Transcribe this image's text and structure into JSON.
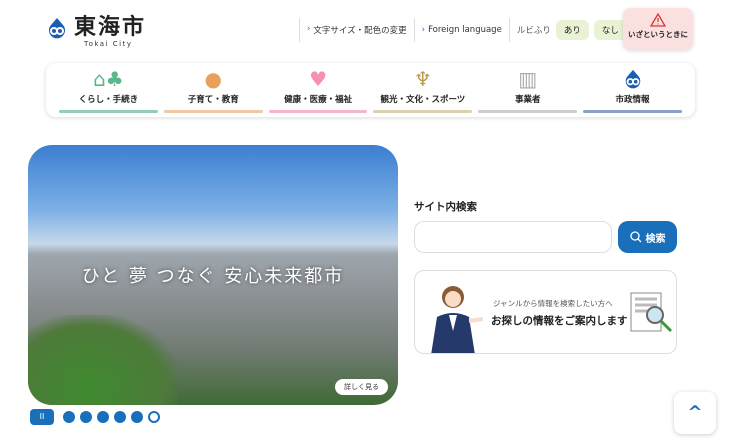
{
  "header": {
    "logo_text": "東海市",
    "logo_sub": "Tokai City",
    "text_size": "文字サイズ・配色の変更",
    "foreign": "Foreign language",
    "ruby_label": "ルビふり",
    "ruby_on": "あり",
    "ruby_off": "なし",
    "emergency": "いざというときに"
  },
  "nav": [
    {
      "label": "くらし・手続き",
      "color": "#8fcfb5"
    },
    {
      "label": "子育て・教育",
      "color": "#efc9a4"
    },
    {
      "label": "健康・医療・福祉",
      "color": "#f6b5cb"
    },
    {
      "label": "観光・文化・スポーツ",
      "color": "#ddd0b0"
    },
    {
      "label": "事業者",
      "color": "#cccccc"
    },
    {
      "label": "市政情報",
      "color": "#8c9fcc"
    }
  ],
  "hero": {
    "catch": "ひと 夢 つなぐ 安心未来都市",
    "more": "詳しく見る",
    "pause": "II",
    "slide_count": 6,
    "active_slide": 6
  },
  "search": {
    "title": "サイト内検索",
    "button": "検索",
    "placeholder": ""
  },
  "guide": {
    "sub": "ジャンルから情報を検索したい方へ",
    "main": "お探しの情報をご案内します"
  },
  "back_to_top": "^"
}
